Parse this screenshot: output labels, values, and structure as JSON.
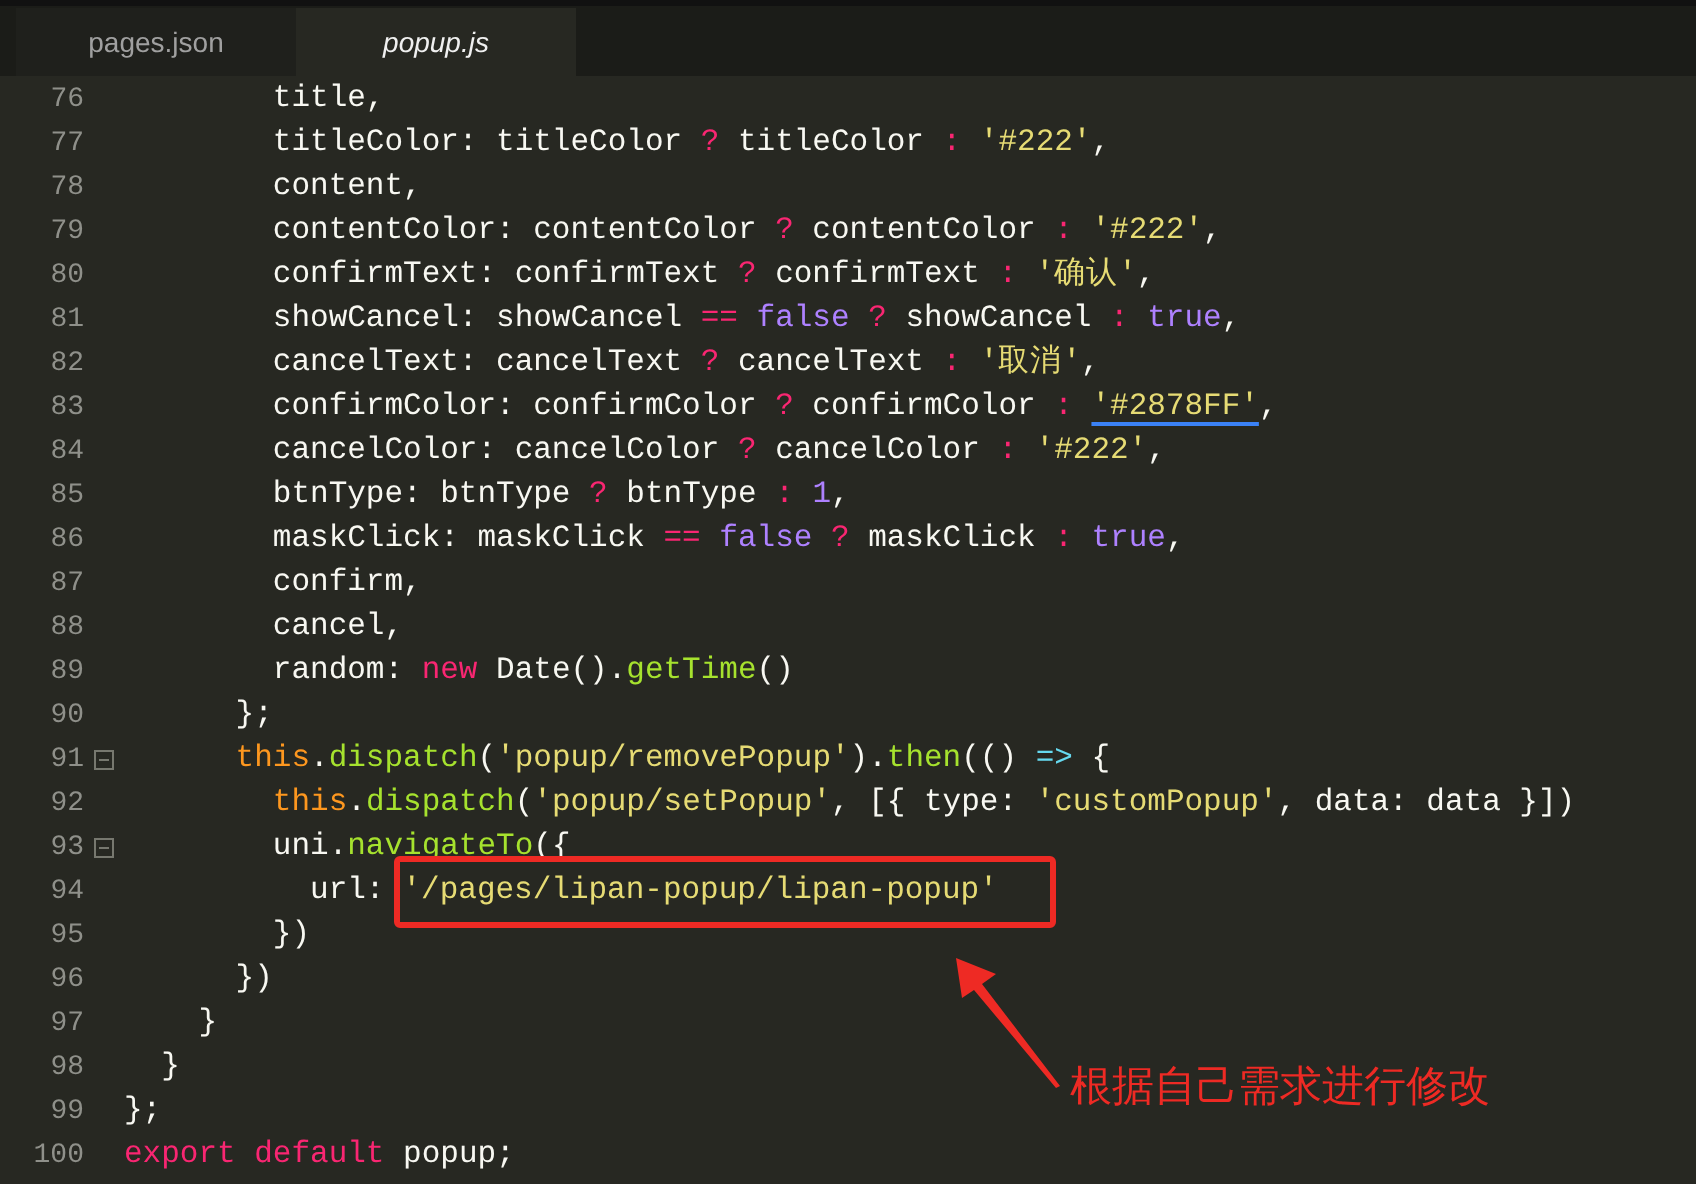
{
  "tabs": [
    {
      "label": "pages.json",
      "selected": false
    },
    {
      "label": "popup.js",
      "selected": true
    }
  ],
  "lines": [
    {
      "number": "76",
      "fold": false,
      "framed": false,
      "tokens": [
        {
          "t": "        title,",
          "kind": "plain"
        }
      ]
    },
    {
      "number": "77",
      "fold": false,
      "framed": false,
      "tokens": [
        {
          "t": "        titleColor: titleColor ",
          "kind": "plain"
        },
        {
          "t": "?",
          "kind": "operator"
        },
        {
          "t": " titleColor ",
          "kind": "plain"
        },
        {
          "t": ":",
          "kind": "operator"
        },
        {
          "t": " '#222'",
          "kind": "string"
        },
        {
          "t": ",",
          "kind": "plain"
        }
      ]
    },
    {
      "number": "78",
      "fold": false,
      "framed": false,
      "tokens": [
        {
          "t": "        content,",
          "kind": "plain"
        }
      ]
    },
    {
      "number": "79",
      "fold": false,
      "framed": false,
      "tokens": [
        {
          "t": "        contentColor: contentColor ",
          "kind": "plain"
        },
        {
          "t": "?",
          "kind": "operator"
        },
        {
          "t": " contentColor ",
          "kind": "plain"
        },
        {
          "t": ":",
          "kind": "operator"
        },
        {
          "t": " '#222'",
          "kind": "string"
        },
        {
          "t": ",",
          "kind": "plain"
        }
      ]
    },
    {
      "number": "80",
      "fold": false,
      "framed": false,
      "tokens": [
        {
          "t": "        confirmText: confirmText ",
          "kind": "plain"
        },
        {
          "t": "?",
          "kind": "operator"
        },
        {
          "t": " confirmText ",
          "kind": "plain"
        },
        {
          "t": ":",
          "kind": "operator"
        },
        {
          "t": " '确认'",
          "kind": "string"
        },
        {
          "t": ",",
          "kind": "plain"
        }
      ]
    },
    {
      "number": "81",
      "fold": false,
      "framed": false,
      "tokens": [
        {
          "t": "        showCancel: showCancel ",
          "kind": "plain"
        },
        {
          "t": "==",
          "kind": "operator"
        },
        {
          "t": " false",
          "kind": "constant"
        },
        {
          "t": " ?",
          "kind": "operator"
        },
        {
          "t": " showCancel ",
          "kind": "plain"
        },
        {
          "t": ":",
          "kind": "operator"
        },
        {
          "t": " true",
          "kind": "constant"
        },
        {
          "t": ",",
          "kind": "plain"
        }
      ]
    },
    {
      "number": "82",
      "fold": false,
      "framed": false,
      "tokens": [
        {
          "t": "        cancelText: cancelText ",
          "kind": "plain"
        },
        {
          "t": "?",
          "kind": "operator"
        },
        {
          "t": " cancelText ",
          "kind": "plain"
        },
        {
          "t": ":",
          "kind": "operator"
        },
        {
          "t": " '取消'",
          "kind": "string"
        },
        {
          "t": ",",
          "kind": "plain"
        }
      ]
    },
    {
      "number": "83",
      "fold": false,
      "framed": false,
      "tokens": [
        {
          "t": "        confirmColor: confirmColor ",
          "kind": "plain"
        },
        {
          "t": "?",
          "kind": "operator"
        },
        {
          "t": " confirmColor ",
          "kind": "plain"
        },
        {
          "t": ": ",
          "kind": "operator"
        },
        {
          "t": "'#2878FF'",
          "kind": "color-string"
        },
        {
          "t": ",",
          "kind": "plain"
        }
      ]
    },
    {
      "number": "84",
      "fold": false,
      "framed": false,
      "tokens": [
        {
          "t": "        cancelColor: cancelColor ",
          "kind": "plain"
        },
        {
          "t": "?",
          "kind": "operator"
        },
        {
          "t": " cancelColor ",
          "kind": "plain"
        },
        {
          "t": ":",
          "kind": "operator"
        },
        {
          "t": " '#222'",
          "kind": "string"
        },
        {
          "t": ",",
          "kind": "plain"
        }
      ]
    },
    {
      "number": "85",
      "fold": false,
      "framed": false,
      "tokens": [
        {
          "t": "        btnType: btnType ",
          "kind": "plain"
        },
        {
          "t": "?",
          "kind": "operator"
        },
        {
          "t": " btnType ",
          "kind": "plain"
        },
        {
          "t": ":",
          "kind": "operator"
        },
        {
          "t": " 1",
          "kind": "constant"
        },
        {
          "t": ",",
          "kind": "plain"
        }
      ]
    },
    {
      "number": "86",
      "fold": false,
      "framed": false,
      "tokens": [
        {
          "t": "        maskClick: maskClick ",
          "kind": "plain"
        },
        {
          "t": "==",
          "kind": "operator"
        },
        {
          "t": " false",
          "kind": "constant"
        },
        {
          "t": " ?",
          "kind": "operator"
        },
        {
          "t": " maskClick ",
          "kind": "plain"
        },
        {
          "t": ":",
          "kind": "operator"
        },
        {
          "t": " true",
          "kind": "constant"
        },
        {
          "t": ",",
          "kind": "plain"
        }
      ]
    },
    {
      "number": "87",
      "fold": false,
      "framed": false,
      "tokens": [
        {
          "t": "        confirm,",
          "kind": "plain"
        }
      ]
    },
    {
      "number": "88",
      "fold": false,
      "framed": false,
      "tokens": [
        {
          "t": "        cancel,",
          "kind": "plain"
        }
      ]
    },
    {
      "number": "89",
      "fold": false,
      "framed": false,
      "tokens": [
        {
          "t": "        random: ",
          "kind": "plain"
        },
        {
          "t": "new",
          "kind": "keyword"
        },
        {
          "t": " Date().",
          "kind": "plain"
        },
        {
          "t": "getTime",
          "kind": "function"
        },
        {
          "t": "()",
          "kind": "plain"
        }
      ]
    },
    {
      "number": "90",
      "fold": false,
      "framed": false,
      "tokens": [
        {
          "t": "      };",
          "kind": "plain"
        }
      ]
    },
    {
      "number": "91",
      "fold": true,
      "framed": false,
      "tokens": [
        {
          "t": "      this",
          "kind": "this"
        },
        {
          "t": ".",
          "kind": "plain"
        },
        {
          "t": "dispatch",
          "kind": "function"
        },
        {
          "t": "(",
          "kind": "plain"
        },
        {
          "t": "'popup/removePopup'",
          "kind": "string"
        },
        {
          "t": ").",
          "kind": "plain"
        },
        {
          "t": "then",
          "kind": "function"
        },
        {
          "t": "(() ",
          "kind": "plain"
        },
        {
          "t": "=>",
          "kind": "arrow"
        },
        {
          "t": " {",
          "kind": "plain"
        }
      ]
    },
    {
      "number": "92",
      "fold": false,
      "framed": false,
      "tokens": [
        {
          "t": "        this",
          "kind": "this"
        },
        {
          "t": ".",
          "kind": "plain"
        },
        {
          "t": "dispatch",
          "kind": "function"
        },
        {
          "t": "(",
          "kind": "plain"
        },
        {
          "t": "'popup/setPopup'",
          "kind": "string"
        },
        {
          "t": ", [{ type: ",
          "kind": "plain"
        },
        {
          "t": "'customPopup'",
          "kind": "string"
        },
        {
          "t": ", data: data }])",
          "kind": "plain"
        }
      ]
    },
    {
      "number": "93",
      "fold": true,
      "framed": false,
      "tokens": [
        {
          "t": "        uni.",
          "kind": "plain"
        },
        {
          "t": "navigateTo",
          "kind": "function"
        },
        {
          "t": "({",
          "kind": "plain"
        }
      ]
    },
    {
      "number": "94",
      "fold": false,
      "framed": true,
      "tokens": [
        {
          "t": "          url:",
          "kind": "plain"
        },
        {
          "t": "'/pages/lipan-popup/lipan-popup'",
          "kind": "string"
        }
      ]
    },
    {
      "number": "95",
      "fold": false,
      "framed": false,
      "tokens": [
        {
          "t": "        })",
          "kind": "plain"
        }
      ]
    },
    {
      "number": "96",
      "fold": false,
      "framed": false,
      "tokens": [
        {
          "t": "      })",
          "kind": "plain"
        }
      ]
    },
    {
      "number": "97",
      "fold": false,
      "framed": false,
      "tokens": [
        {
          "t": "    }",
          "kind": "plain"
        }
      ]
    },
    {
      "number": "98",
      "fold": false,
      "framed": false,
      "tokens": [
        {
          "t": "  }",
          "kind": "plain"
        }
      ]
    },
    {
      "number": "99",
      "fold": false,
      "framed": false,
      "tokens": [
        {
          "t": "};",
          "kind": "plain"
        }
      ]
    },
    {
      "number": "100",
      "fold": false,
      "framed": false,
      "tokens": [
        {
          "t": "export",
          "kind": "keyword"
        },
        {
          "t": " default",
          "kind": "keyword"
        },
        {
          "t": " popup;",
          "kind": "plain"
        }
      ]
    }
  ],
  "annotation": {
    "text": "根据自己需求进行修改"
  }
}
